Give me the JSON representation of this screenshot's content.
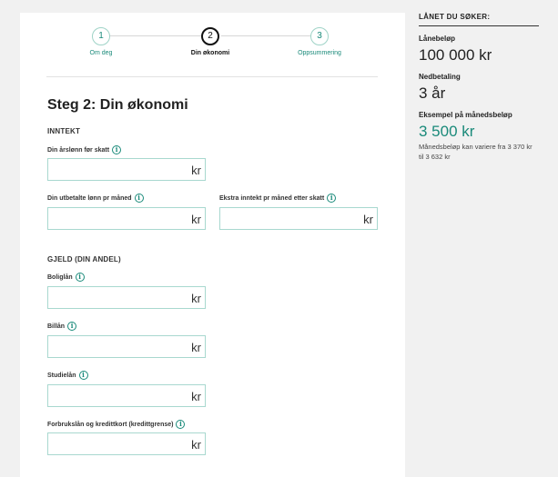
{
  "stepper": {
    "steps": [
      {
        "number": "1",
        "label": "Om deg"
      },
      {
        "number": "2",
        "label": "Din økonomi"
      },
      {
        "number": "3",
        "label": "Oppsummering"
      }
    ]
  },
  "form": {
    "heading": "Steg 2: Din økonomi",
    "sections": {
      "income": "INNTEKT",
      "debt": "GJELD (DIN ANDEL)"
    },
    "unit": "kr",
    "info_glyph": "i",
    "fields": {
      "annual_salary": {
        "label": "Din årslønn før skatt",
        "value": ""
      },
      "net_salary": {
        "label": "Din utbetalte lønn pr måned",
        "value": ""
      },
      "extra_income": {
        "label": "Ekstra inntekt pr måned etter skatt",
        "value": ""
      },
      "mortgage": {
        "label": "Boliglån",
        "value": ""
      },
      "car_loan": {
        "label": "Billån",
        "value": ""
      },
      "student_loan": {
        "label": "Studielån",
        "value": ""
      },
      "consumer_loan": {
        "label": "Forbrukslån og kredittkort (kredittgrense)",
        "value": ""
      }
    }
  },
  "summary": {
    "title": "LÅNET DU SØKER:",
    "loan_amount_label": "Lånebeløp",
    "loan_amount": "100 000 kr",
    "repayment_label": "Nedbetaling",
    "repayment": "3 år",
    "monthly_label": "Eksempel på månedsbeløp",
    "monthly": "3 500 kr",
    "note": "Månedsbeløp kan variere fra 3 370 kr til 3 632 kr"
  },
  "colors": {
    "accent": "#1a8a7a",
    "input_border": "#a8d8cf",
    "background": "#f1f1f1"
  },
  "icons": {
    "info": "info-icon"
  }
}
